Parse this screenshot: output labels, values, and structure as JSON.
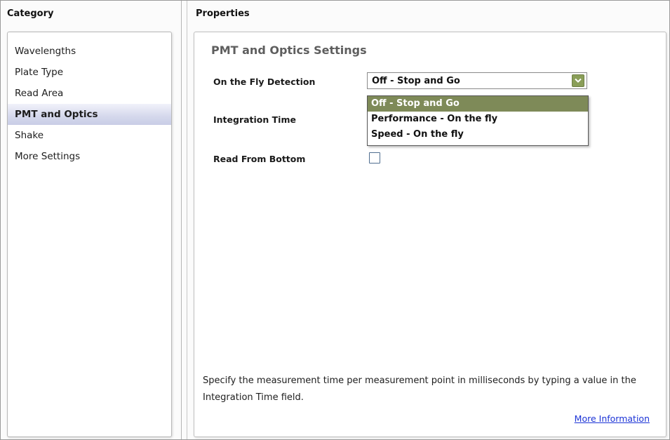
{
  "category": {
    "header": "Category",
    "items": [
      {
        "label": "Wavelengths",
        "selected": false
      },
      {
        "label": "Plate Type",
        "selected": false
      },
      {
        "label": "Read Area",
        "selected": false
      },
      {
        "label": "PMT and Optics",
        "selected": true
      },
      {
        "label": "Shake",
        "selected": false
      },
      {
        "label": "More Settings",
        "selected": false
      }
    ]
  },
  "properties": {
    "header": "Properties",
    "section_title": "PMT and Optics Settings",
    "on_the_fly": {
      "label": "On the Fly Detection",
      "value": "Off - Stop and Go",
      "options": [
        "Off - Stop and Go",
        "Performance - On the fly",
        "Speed - On the fly"
      ],
      "selected_index": 0
    },
    "integration_time": {
      "label": "Integration Time"
    },
    "read_from_bottom": {
      "label": "Read From Bottom",
      "checked": false
    },
    "help_text": "Specify the measurement time per measurement point in milliseconds by typing a value in the Integration Time field.",
    "more_info_label": "More Information"
  },
  "colors": {
    "selection_green": "#7e8a58",
    "link_blue": "#1b33d6",
    "category_selected": "#d5d8ec"
  }
}
